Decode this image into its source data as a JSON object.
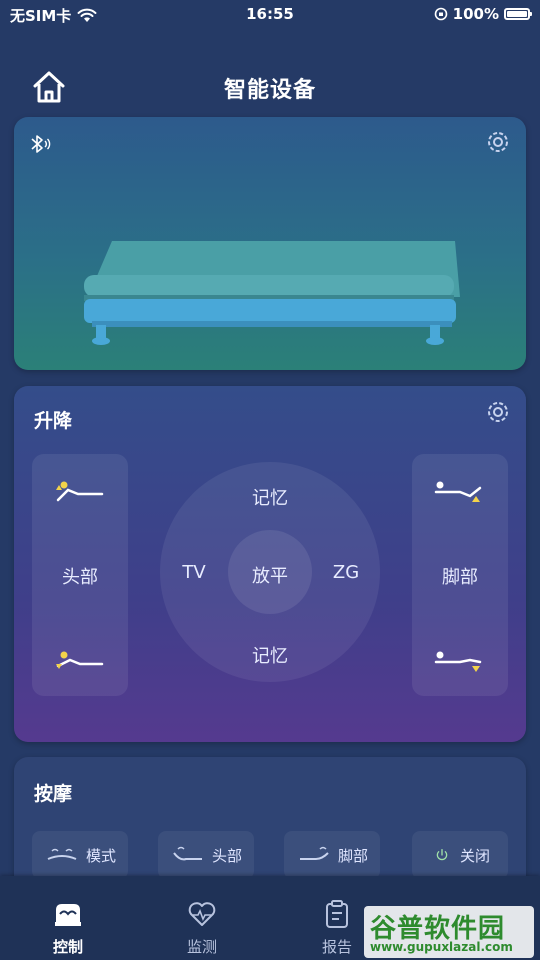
{
  "status_bar": {
    "carrier": "无SIM卡",
    "time": "16:55",
    "battery": "100%"
  },
  "header": {
    "title": "智能设备"
  },
  "lift": {
    "title": "升降",
    "head_label": "头部",
    "foot_label": "脚部",
    "dial": {
      "top": "记忆",
      "bottom": "记忆",
      "left": "TV",
      "right": "ZG",
      "center": "放平"
    }
  },
  "massage": {
    "title": "按摩",
    "buttons": [
      {
        "label": "模式"
      },
      {
        "label": "头部"
      },
      {
        "label": "脚部"
      },
      {
        "label": "关闭"
      }
    ]
  },
  "tabs": [
    {
      "label": "控制",
      "active": true
    },
    {
      "label": "监测",
      "active": false
    },
    {
      "label": "报告",
      "active": false
    }
  ],
  "watermark": {
    "title": "谷普软件园",
    "url": "www.gupuxlazal.com"
  },
  "colors": {
    "background": "#253a66",
    "accent_yellow": "#f3d34a",
    "bed_blue": "#49a8d8"
  }
}
